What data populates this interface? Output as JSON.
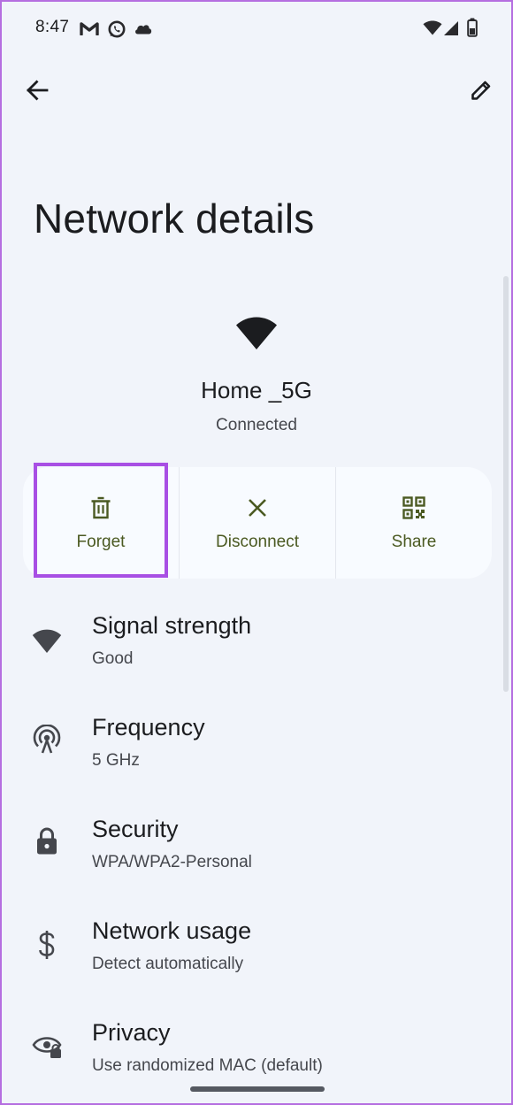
{
  "status_bar": {
    "time": "8:47",
    "left_icons": [
      "gmail-m-icon",
      "whatsapp-icon",
      "cloud-icon"
    ],
    "right_icons": [
      "wifi-icon",
      "cellular-signal-icon",
      "battery-icon"
    ]
  },
  "app_bar": {
    "back_icon": "arrow-left-icon",
    "edit_icon": "pencil-icon"
  },
  "page": {
    "title": "Network details"
  },
  "network": {
    "icon": "wifi-icon",
    "name": "Home _5G",
    "status": "Connected"
  },
  "actions": [
    {
      "label": "Forget",
      "icon": "trash-icon"
    },
    {
      "label": "Disconnect",
      "icon": "close-icon"
    },
    {
      "label": "Share",
      "icon": "qr-code-icon"
    }
  ],
  "details": [
    {
      "title": "Signal strength",
      "value": "Good",
      "icon": "wifi-icon"
    },
    {
      "title": "Frequency",
      "value": "5 GHz",
      "icon": "antenna-icon"
    },
    {
      "title": "Security",
      "value": "WPA/WPA2-Personal",
      "icon": "lock-icon"
    },
    {
      "title": "Network usage",
      "value": "Detect automatically",
      "icon": "dollar-icon"
    },
    {
      "title": "Privacy",
      "value": "Use randomized MAC (default)",
      "icon": "eye-lock-icon"
    }
  ],
  "colors": {
    "background": "#f1f4fa",
    "card": "#f8fbff",
    "action_accent": "#4b5a22",
    "highlight": "#a84fe4",
    "text_primary": "#1b1c1f",
    "text_secondary": "#45474d"
  }
}
